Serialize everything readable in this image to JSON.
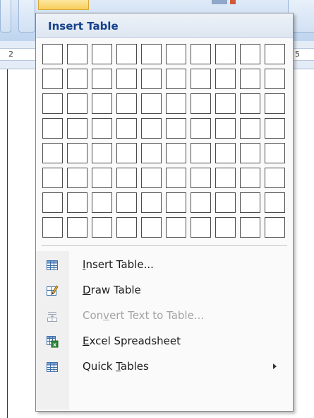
{
  "ruler": {
    "left_number": "2",
    "right_number": "5"
  },
  "menu": {
    "title": "Insert Table",
    "grid": {
      "rows": 8,
      "columns": 10
    },
    "items": [
      {
        "label_pre": "",
        "mnemonic": "I",
        "label_post": "nsert Table...",
        "icon": "insert-table-icon",
        "enabled": true,
        "submenu": false
      },
      {
        "label_pre": "",
        "mnemonic": "D",
        "label_post": "raw Table",
        "icon": "draw-table-icon",
        "enabled": true,
        "submenu": false
      },
      {
        "label_pre": "Con",
        "mnemonic": "v",
        "label_post": "ert Text to Table...",
        "icon": "convert-text-to-table-icon",
        "enabled": false,
        "submenu": false
      },
      {
        "label_pre": "",
        "mnemonic": "E",
        "label_post": "xcel Spreadsheet",
        "icon": "excel-spreadsheet-icon",
        "enabled": true,
        "submenu": false
      },
      {
        "label_pre": "Quick ",
        "mnemonic": "T",
        "label_post": "ables",
        "icon": "quick-tables-icon",
        "enabled": true,
        "submenu": true
      }
    ]
  },
  "colors": {
    "title": "#15428b",
    "grid_border": "#4c4c4c",
    "disabled_text": "#a3a3a3"
  }
}
